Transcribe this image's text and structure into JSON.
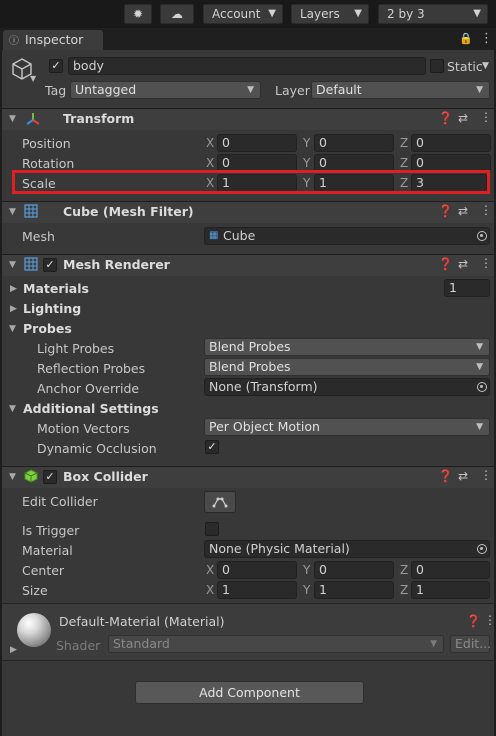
{
  "toolbar": {
    "account_label": "Account",
    "layers_label": "Layers",
    "layout_label": "2 by 3"
  },
  "window": {
    "tab_title": "Inspector"
  },
  "object": {
    "name": "body",
    "static_label": "Static",
    "tag_label": "Tag",
    "tag_value": "Untagged",
    "layer_label": "Layer",
    "layer_value": "Default"
  },
  "transform": {
    "title": "Transform",
    "position_label": "Position",
    "rotation_label": "Rotation",
    "scale_label": "Scale",
    "axes": [
      "X",
      "Y",
      "Z"
    ],
    "position": [
      "0",
      "0",
      "0"
    ],
    "rotation": [
      "0",
      "0",
      "0"
    ],
    "scale": [
      "1",
      "1",
      "3"
    ],
    "highlight_color": "#e02020"
  },
  "mesh_filter": {
    "title": "Cube (Mesh Filter)",
    "mesh_label": "Mesh",
    "mesh_value": "Cube"
  },
  "mesh_renderer": {
    "title": "Mesh Renderer",
    "materials_label": "Materials",
    "materials_count": "1",
    "lighting_label": "Lighting",
    "probes_label": "Probes",
    "light_probes_label": "Light Probes",
    "light_probes_value": "Blend Probes",
    "reflection_probes_label": "Reflection Probes",
    "reflection_probes_value": "Blend Probes",
    "anchor_override_label": "Anchor Override",
    "anchor_override_value": "None (Transform)",
    "additional_settings_label": "Additional Settings",
    "motion_vectors_label": "Motion Vectors",
    "motion_vectors_value": "Per Object Motion",
    "dynamic_occlusion_label": "Dynamic Occlusion"
  },
  "box_collider": {
    "title": "Box Collider",
    "edit_collider_label": "Edit Collider",
    "is_trigger_label": "Is Trigger",
    "material_label": "Material",
    "material_value": "None (Physic Material)",
    "center_label": "Center",
    "size_label": "Size",
    "center": [
      "0",
      "0",
      "0"
    ],
    "size": [
      "1",
      "1",
      "1"
    ]
  },
  "material": {
    "title": "Default-Material (Material)",
    "shader_label": "Shader",
    "shader_value": "Standard",
    "edit_label": "Edit..."
  },
  "add_component_label": "Add Component",
  "colors": {
    "accent_check": "#e6e6e6",
    "collider_icon": "#7ad13a"
  }
}
